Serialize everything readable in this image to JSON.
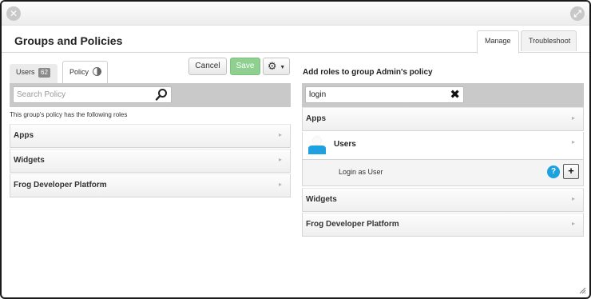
{
  "window": {
    "close_glyph": "✕",
    "expand_glyph": "⤢"
  },
  "header": {
    "title": "Groups and Policies",
    "tabs": [
      {
        "label": "Manage",
        "active": true
      },
      {
        "label": "Troubleshoot",
        "active": false
      }
    ]
  },
  "left": {
    "tabs": {
      "users_label": "Users",
      "users_count": "62",
      "policy_label": "Policy"
    },
    "buttons": {
      "cancel": "Cancel",
      "save": "Save",
      "gear_glyph": "⚙",
      "caret_glyph": "▼"
    },
    "search": {
      "placeholder": "Search Policy"
    },
    "caption": "This group's policy has the following roles",
    "sections": [
      {
        "label": "Apps"
      },
      {
        "label": "Widgets"
      },
      {
        "label": "Frog Developer Platform"
      }
    ]
  },
  "right": {
    "title": "Add roles to group Admin's policy",
    "search": {
      "value": "login",
      "clear_glyph": "✖"
    },
    "sections": [
      {
        "label": "Apps"
      },
      {
        "label": "Widgets"
      },
      {
        "label": "Frog Developer Platform"
      }
    ],
    "users_item": {
      "label": "Users"
    },
    "role": {
      "label": "Login as User",
      "help_glyph": "?",
      "add_glyph": "+"
    }
  },
  "chevron_glyph": "▸",
  "colors": {
    "save_button": "#8fcf8f",
    "help_icon": "#1da1e0",
    "avatar": "#1da1e0",
    "search_bar": "#c9c9c9"
  }
}
